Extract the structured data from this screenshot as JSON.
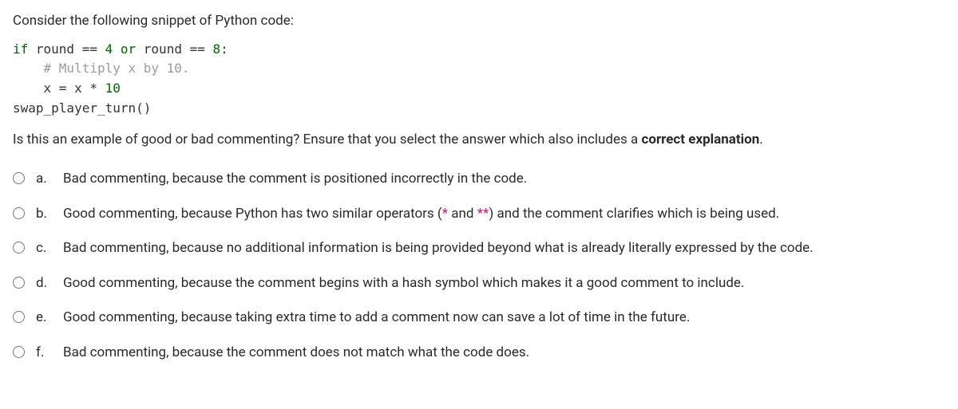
{
  "question": {
    "intro": "Consider the following snippet of Python code:",
    "code": {
      "line1_pre": "if",
      "line1_mid1": " round ",
      "line1_eq1": "== ",
      "line1_n1": "4",
      "line1_or": " or",
      "line1_mid2": " round ",
      "line1_eq2": "== ",
      "line1_n2": "8",
      "line1_colon": ":",
      "line2": "    # Multiply x by 10.",
      "line3_pre": "    x = x * ",
      "line3_n": "10",
      "line4": "swap_player_turn()"
    },
    "body_pre": "Is this an example of good or bad commenting? Ensure that you select the answer which also includes a ",
    "body_bold": "correct explanation",
    "body_post": "."
  },
  "options": [
    {
      "letter": "a.",
      "text": "Bad commenting, because the comment is positioned incorrectly in the code."
    },
    {
      "letter": "b.",
      "text_pre": "Good commenting, because Python has two similar operators (",
      "op1": "*",
      "mid": " and ",
      "op2": "**",
      "text_post": ") and the comment clarifies which is being used."
    },
    {
      "letter": "c.",
      "text": "Bad commenting, because no additional information is being provided beyond what is already literally expressed by the code."
    },
    {
      "letter": "d.",
      "text": "Good commenting, because the comment begins with a hash symbol which makes it a good comment to include."
    },
    {
      "letter": "e.",
      "text": "Good commenting, because taking extra time to add a comment now can save a lot of time in the future."
    },
    {
      "letter": "f.",
      "text": "Bad commenting, because the comment does not match what the code does."
    }
  ]
}
